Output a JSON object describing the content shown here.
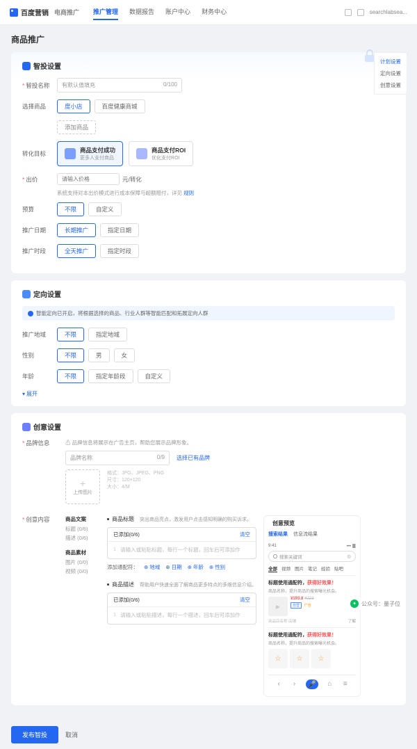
{
  "header": {
    "brand": "百度营销",
    "brandSub": "电商推广",
    "tabs": [
      "推广管理",
      "数据报告",
      "账户中心",
      "财务中心"
    ],
    "activeTab": 0,
    "user": "searchlabsea..."
  },
  "page": {
    "title": "商品推广"
  },
  "sideNav": {
    "items": [
      "计划设置",
      "定向设置",
      "创意设置"
    ],
    "active": 0
  },
  "smart": {
    "title": "智投设置",
    "labels": {
      "name": "智投名称",
      "shop": "选择商品",
      "goal": "转化目标",
      "bid": "出价",
      "budget": "预算",
      "date": "推广日期",
      "time": "推广时段"
    },
    "nameInput": {
      "placeholder": "有默认值填充",
      "counter": "0/100"
    },
    "shopOptions": [
      "度小店",
      "百度健康商城"
    ],
    "shopActive": 0,
    "addProduct": "添加商品",
    "goals": [
      {
        "title": "商品支付成功",
        "sub": "更多人支付商品"
      },
      {
        "title": "商品支付ROI",
        "sub": "优化支付ROI"
      }
    ],
    "goalActive": 0,
    "bid": {
      "placeholder": "请输入价格",
      "unit": "元/转化"
    },
    "bidHint": {
      "text": "系统支持对本出价模式进行成本保障与超额赔付，详见 ",
      "link": "规则"
    },
    "budgetOptions": [
      "不限",
      "自定义"
    ],
    "budgetActive": 0,
    "dateOptions": [
      "长期推广",
      "指定日期"
    ],
    "dateActive": 0,
    "timeOptions": [
      "全天推广",
      "指定时段"
    ],
    "timeActive": 0
  },
  "targeting": {
    "title": "定向设置",
    "banner": "智能定向已开启，将根据选择的商品、行业人群等智能匹配和拓展定向人群",
    "labels": {
      "region": "推广地域",
      "gender": "性别",
      "age": "年龄"
    },
    "regionOptions": [
      "不限",
      "指定地域"
    ],
    "regionActive": 0,
    "genderOptions": [
      "不限",
      "男",
      "女"
    ],
    "genderActive": 0,
    "ageOptions": [
      "不限",
      "指定年龄段",
      "自定义"
    ],
    "ageActive": 0,
    "expand": "展开"
  },
  "creative": {
    "title": "创意设置",
    "brand": {
      "label": "品牌信息",
      "hint": "品牌信息将展示在广告主页，帮助您展示品牌形象。",
      "nameLabel": "品牌名称",
      "nameCounter": "0/9",
      "selectExisting": "选择已有品牌",
      "upload": "上传图片",
      "formats": [
        "格式：JPG、JPEG、PNG",
        "尺寸：120×120",
        "大小：4/M"
      ]
    },
    "content": {
      "label": "创意内容",
      "side": [
        {
          "title": "商品文案",
          "items": [
            "标题 (0/6)",
            "描述 (0/6)"
          ]
        },
        {
          "title": "商品素材",
          "items": [
            "图片 (0/0)",
            "视频 (0/0)"
          ]
        }
      ],
      "titleSec": {
        "label": "商品标题",
        "hint": "突出商品亮点，激发用户点击感知明确的购买诉求。",
        "added": "已添加(0/6)",
        "clear": "清空",
        "placeholder": "请输入或粘贴标题，每行一个标题，回车后可添加作"
      },
      "matchRow": {
        "label": "添加通配符：",
        "tags": [
          "地域",
          "日期",
          "年龄",
          "性别"
        ]
      },
      "descSec": {
        "label": "商品描述",
        "hint": "帮助用户快速全面了解商品更多特点的多维信息介绍。",
        "added": "已添加(0/6)",
        "clear": "清空",
        "placeholder": "请输入或粘贴描述，每行一个描述，回车后可添加作"
      }
    },
    "preview": {
      "title": "创意预览",
      "tabs": [
        "搜索结果",
        "信息流结果"
      ],
      "tabActive": 0,
      "time": "9:41",
      "search": "搜索关键词",
      "cats": [
        "全部",
        "视频",
        "图片",
        "笔记",
        "经验",
        "贴吧"
      ],
      "result1": {
        "title": "标题使用通配符，",
        "titleHL": "获得好效果！",
        "sub": "商品名称，提升商品的搜索曝光机会。",
        "price": "¥193.8",
        "oldPrice": "¥223",
        "tag1": "自营",
        "tag2": "广告",
        "shop": "商品店名称 店铺",
        "action": "了解"
      },
      "result2": {
        "title": "标题使用通配符，",
        "titleHL": "获得好效果！",
        "sub": "商品名称，提升商品的搜索曝光机会。"
      }
    }
  },
  "footer": {
    "publish": "发布智投",
    "cancel": "取消"
  },
  "watermark": {
    "label": "公众号：量子位"
  }
}
